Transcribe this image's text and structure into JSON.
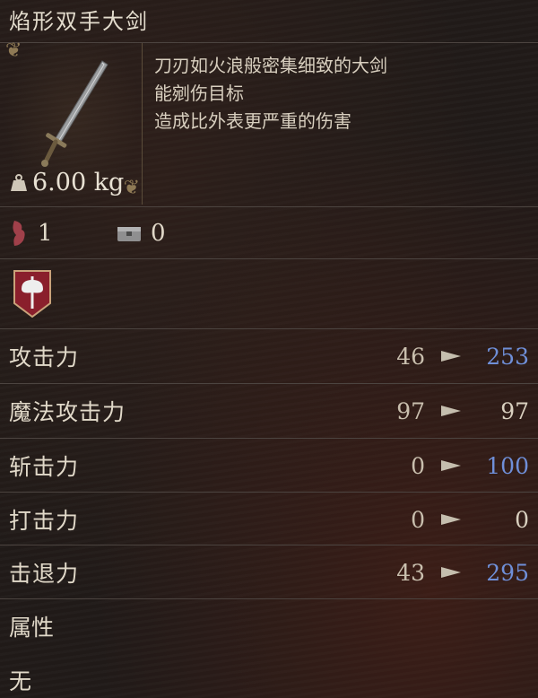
{
  "item": {
    "name": "焰形双手大剑",
    "weight": "6.00 kg",
    "description": [
      "刀刃如火浪般密集细致的大剑",
      "能剜伤目标",
      "造成比外表更严重的伤害"
    ]
  },
  "requirements": {
    "strength": "1",
    "chest": "0"
  },
  "stats": [
    {
      "label": "攻击力",
      "base": "46",
      "value": "253",
      "change": "up"
    },
    {
      "label": "魔法攻击力",
      "base": "97",
      "value": "97",
      "change": "same"
    },
    {
      "label": "斩击力",
      "base": "0",
      "value": "100",
      "change": "up"
    },
    {
      "label": "打击力",
      "base": "0",
      "value": "0",
      "change": "same"
    },
    {
      "label": "击退力",
      "base": "43",
      "value": "295",
      "change": "up"
    }
  ],
  "attribute": {
    "label": "属性",
    "value": "无"
  },
  "colors": {
    "increase": "#6f8fd8",
    "text": "#d9d0bf",
    "divider": "#4c4440"
  },
  "icons": [
    "weight-icon",
    "strength-icon",
    "chest-icon",
    "axe-badge-icon",
    "arrow-right-icon"
  ]
}
